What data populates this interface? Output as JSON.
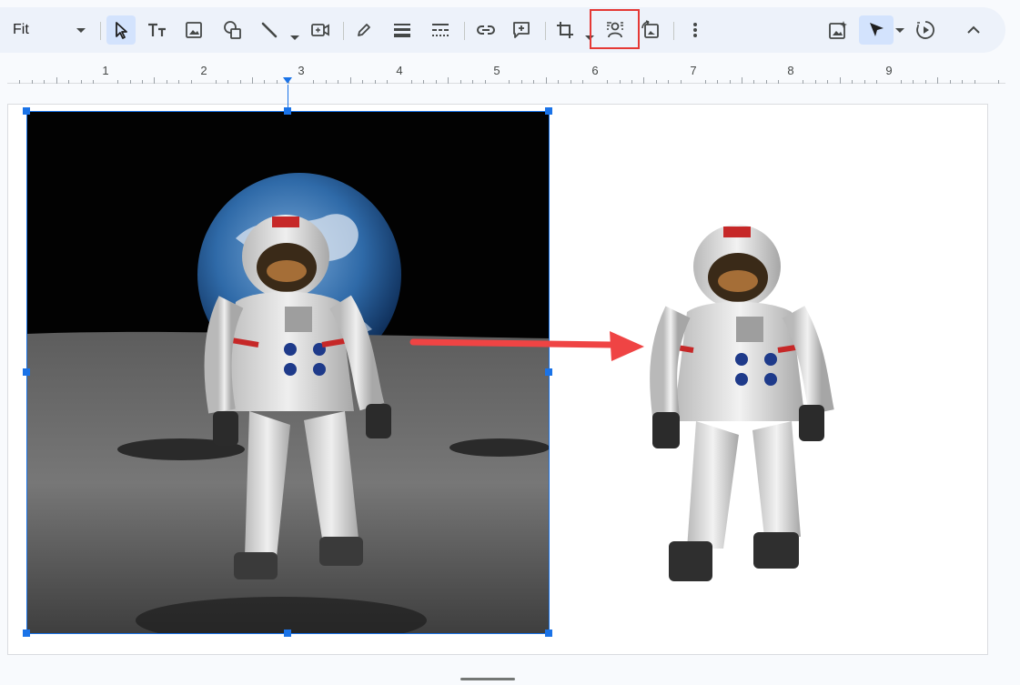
{
  "toolbar": {
    "zoom_value": "Fit",
    "buttons": [
      {
        "name": "select-tool",
        "icon": "cursor-arrow-icon",
        "active": true
      },
      {
        "name": "text-box",
        "icon": "text-box-icon"
      },
      {
        "name": "insert-image",
        "icon": "image-icon"
      },
      {
        "name": "shape",
        "icon": "shape-icon"
      },
      {
        "name": "line",
        "icon": "line-icon"
      },
      {
        "name": "video",
        "icon": "video-icon"
      },
      {
        "name": "border-color",
        "icon": "pencil-icon"
      },
      {
        "name": "border-weight",
        "icon": "border-weight-icon"
      },
      {
        "name": "border-dash",
        "icon": "border-dash-icon"
      },
      {
        "name": "insert-link",
        "icon": "link-icon"
      },
      {
        "name": "add-comment",
        "icon": "comment-add-icon"
      },
      {
        "name": "crop-image",
        "icon": "crop-icon"
      },
      {
        "name": "remove-background",
        "icon": "remove-background-icon",
        "highlighted": true
      },
      {
        "name": "replace-image",
        "icon": "replace-image-icon"
      },
      {
        "name": "more-options",
        "icon": "more-vert-icon"
      },
      {
        "name": "generate-image",
        "icon": "image-sparkle-icon"
      },
      {
        "name": "pointer-mode",
        "icon": "pointer-icon",
        "active": true
      },
      {
        "name": "slideshow",
        "icon": "play-circle-icon"
      },
      {
        "name": "collapse-menus",
        "icon": "chevron-up-icon"
      }
    ]
  },
  "ruler": {
    "labels": [
      "1",
      "2",
      "3",
      "4",
      "5",
      "6",
      "7",
      "8",
      "9"
    ]
  },
  "canvas": {
    "original_image": "astronaut-on-moon-with-earth",
    "cutout_image": "astronaut-background-removed"
  },
  "colors": {
    "accent": "#1a73e8",
    "highlight": "#e53935",
    "arrow": "#ef4444"
  }
}
